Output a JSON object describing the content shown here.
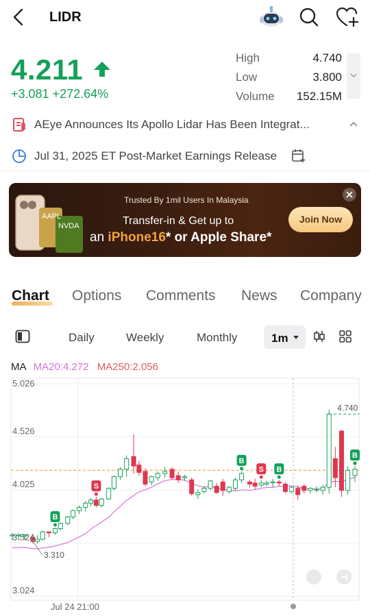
{
  "header": {
    "title": "LIDR"
  },
  "quote": {
    "price": "4.211",
    "change": "+3.081 +272.64%",
    "stats": [
      {
        "label": "High",
        "value": "4.740"
      },
      {
        "label": "Low",
        "value": "3.800"
      },
      {
        "label": "Volume",
        "value": "152.15M"
      }
    ]
  },
  "news": {
    "headline": "AEye Announces Its Apollo Lidar Has Been Integrat..."
  },
  "earnings": {
    "text": "Jul 31, 2025 ET Post-Market Earnings Release"
  },
  "banner": {
    "trusted": "Trusted By 1mil Users In Malaysia",
    "line1": "Transfer-in & Get up to",
    "line2_prefix": "an ",
    "line2_highlight": "iPhone16",
    "line2_suffix": "* or Apple Share*",
    "join_label": "Join Now",
    "phone_labels": [
      "AAPL",
      "NVDA"
    ]
  },
  "tabs": [
    "Chart",
    "Options",
    "Comments",
    "News",
    "Company"
  ],
  "active_tab": "Chart",
  "periods": [
    "Daily",
    "Weekly",
    "Monthly"
  ],
  "active_period": "1m",
  "ma_legend": {
    "label": "MA",
    "ma20": "MA20:4.272",
    "ma250": "MA250:2.056"
  },
  "colors": {
    "up": "#14a05a",
    "down": "#e0374f",
    "ma20": "#d674d6",
    "ref_line": "#f0902a",
    "accent": "#f0b05a"
  },
  "chart_data": {
    "type": "candlestick",
    "interval": "1m",
    "y_ticks": [
      "5.026",
      "4.526",
      "4.025",
      "3.524",
      "3.024"
    ],
    "ylim": [
      3.024,
      5.026
    ],
    "x_tick_label": "Jul 24 21:00",
    "reference_price": 4.211,
    "annotations": {
      "low_label": "3.310",
      "high_label": "4.740"
    },
    "candles": [
      {
        "o": 3.6,
        "h": 3.62,
        "l": 3.55,
        "c": 3.6
      },
      {
        "o": 3.6,
        "h": 3.62,
        "l": 3.55,
        "c": 3.6
      },
      {
        "o": 3.59,
        "h": 3.61,
        "l": 3.55,
        "c": 3.6
      },
      {
        "o": 3.58,
        "h": 3.6,
        "l": 3.52,
        "c": 3.54
      },
      {
        "o": 3.54,
        "h": 3.6,
        "l": 3.52,
        "c": 3.56
      },
      {
        "o": 3.56,
        "h": 3.64,
        "l": 3.55,
        "c": 3.63
      },
      {
        "o": 3.63,
        "h": 3.62,
        "l": 3.58,
        "c": 3.62
      },
      {
        "o": 3.62,
        "h": 3.67,
        "l": 3.6,
        "c": 3.66
      },
      {
        "o": 3.66,
        "h": 3.72,
        "l": 3.64,
        "c": 3.71
      },
      {
        "o": 3.71,
        "h": 3.78,
        "l": 3.69,
        "c": 3.77
      },
      {
        "o": 3.77,
        "h": 3.84,
        "l": 3.75,
        "c": 3.83
      },
      {
        "o": 3.83,
        "h": 3.88,
        "l": 3.8,
        "c": 3.86
      },
      {
        "o": 3.86,
        "h": 3.92,
        "l": 3.82,
        "c": 3.9
      },
      {
        "o": 3.9,
        "h": 3.95,
        "l": 3.87,
        "c": 3.93
      },
      {
        "o": 3.93,
        "h": 3.96,
        "l": 3.86,
        "c": 3.88
      },
      {
        "o": 3.88,
        "h": 3.95,
        "l": 3.86,
        "c": 3.94
      },
      {
        "o": 3.94,
        "h": 4.05,
        "l": 3.93,
        "c": 4.04
      },
      {
        "o": 4.04,
        "h": 4.16,
        "l": 4.02,
        "c": 4.15
      },
      {
        "o": 4.15,
        "h": 4.24,
        "l": 4.12,
        "c": 4.22
      },
      {
        "o": 4.22,
        "h": 4.35,
        "l": 4.15,
        "c": 4.32
      },
      {
        "o": 4.34,
        "h": 4.55,
        "l": 4.18,
        "c": 4.25
      },
      {
        "o": 4.26,
        "h": 4.3,
        "l": 4.16,
        "c": 4.19
      },
      {
        "o": 4.2,
        "h": 4.23,
        "l": 4.06,
        "c": 4.08
      },
      {
        "o": 4.1,
        "h": 4.16,
        "l": 4.07,
        "c": 4.15
      },
      {
        "o": 4.14,
        "h": 4.2,
        "l": 4.11,
        "c": 4.18
      },
      {
        "o": 4.18,
        "h": 4.24,
        "l": 4.14,
        "c": 4.2
      },
      {
        "o": 4.22,
        "h": 4.24,
        "l": 4.12,
        "c": 4.14
      },
      {
        "o": 4.16,
        "h": 4.2,
        "l": 4.09,
        "c": 4.12
      },
      {
        "o": 4.14,
        "h": 4.17,
        "l": 4.11,
        "c": 4.15
      },
      {
        "o": 4.12,
        "h": 4.14,
        "l": 3.97,
        "c": 3.99
      },
      {
        "o": 3.98,
        "h": 4.03,
        "l": 3.94,
        "c": 4.0
      },
      {
        "o": 4.01,
        "h": 4.06,
        "l": 3.99,
        "c": 4.04
      },
      {
        "o": 4.04,
        "h": 4.12,
        "l": 4.02,
        "c": 4.11
      },
      {
        "o": 4.06,
        "h": 4.09,
        "l": 3.99,
        "c": 4.0
      },
      {
        "o": 4.1,
        "h": 4.13,
        "l": 3.97,
        "c": 4.02
      },
      {
        "o": 4.01,
        "h": 4.06,
        "l": 3.99,
        "c": 4.05
      },
      {
        "o": 4.04,
        "h": 4.14,
        "l": 4.02,
        "c": 4.12
      },
      {
        "o": 4.12,
        "h": 4.2,
        "l": 4.09,
        "c": 4.18
      },
      {
        "o": 4.1,
        "h": 4.12,
        "l": 4.05,
        "c": 4.08
      },
      {
        "o": 4.09,
        "h": 4.13,
        "l": 4.03,
        "c": 4.06
      },
      {
        "o": 4.07,
        "h": 4.12,
        "l": 4.05,
        "c": 4.09
      },
      {
        "o": 4.08,
        "h": 4.11,
        "l": 4.06,
        "c": 4.09
      },
      {
        "o": 4.1,
        "h": 4.13,
        "l": 4.05,
        "c": 4.1
      },
      {
        "o": 4.1,
        "h": 4.12,
        "l": 4.06,
        "c": 4.09
      },
      {
        "o": 4.08,
        "h": 4.1,
        "l": 3.99,
        "c": 4.01
      },
      {
        "o": 4.01,
        "h": 4.06,
        "l": 3.99,
        "c": 4.05
      },
      {
        "o": 4.04,
        "h": 4.07,
        "l": 3.93,
        "c": 3.98
      },
      {
        "o": 4.06,
        "h": 4.08,
        "l": 3.99,
        "c": 4.02
      },
      {
        "o": 4.02,
        "h": 4.05,
        "l": 3.99,
        "c": 4.04
      },
      {
        "o": 4.03,
        "h": 4.06,
        "l": 4.0,
        "c": 4.03
      },
      {
        "o": 4.02,
        "h": 4.07,
        "l": 3.98,
        "c": 4.05
      },
      {
        "o": 4.05,
        "h": 4.78,
        "l": 3.99,
        "c": 4.74
      },
      {
        "o": 4.32,
        "h": 4.43,
        "l": 4.05,
        "c": 4.14
      },
      {
        "o": 4.58,
        "h": 4.59,
        "l": 3.96,
        "c": 4.02
      },
      {
        "o": 4.02,
        "h": 4.25,
        "l": 3.98,
        "c": 4.21
      },
      {
        "o": 4.16,
        "h": 4.25,
        "l": 4.1,
        "c": 4.22
      }
    ],
    "x_positions": [
      20,
      27,
      34,
      43,
      48,
      54,
      61,
      68,
      74,
      82,
      88,
      95,
      102,
      108,
      114,
      120,
      128,
      134,
      141,
      148,
      156,
      162,
      169,
      176,
      183,
      191,
      199,
      206,
      213,
      221,
      228,
      235,
      242,
      249,
      256,
      263,
      270,
      277,
      286,
      292,
      299,
      305,
      312,
      319,
      326,
      333,
      340,
      347,
      354,
      361,
      368,
      375,
      382,
      389,
      396,
      404
    ],
    "trade_markers": [
      {
        "type": "B",
        "candle": 7
      },
      {
        "type": "S",
        "candle": 14
      },
      {
        "type": "B",
        "candle": 37
      },
      {
        "type": "S",
        "candle": 40
      },
      {
        "type": "B",
        "candle": 43
      },
      {
        "type": "S",
        "candle": 55
      },
      {
        "type": "B",
        "candle": 62
      }
    ]
  }
}
